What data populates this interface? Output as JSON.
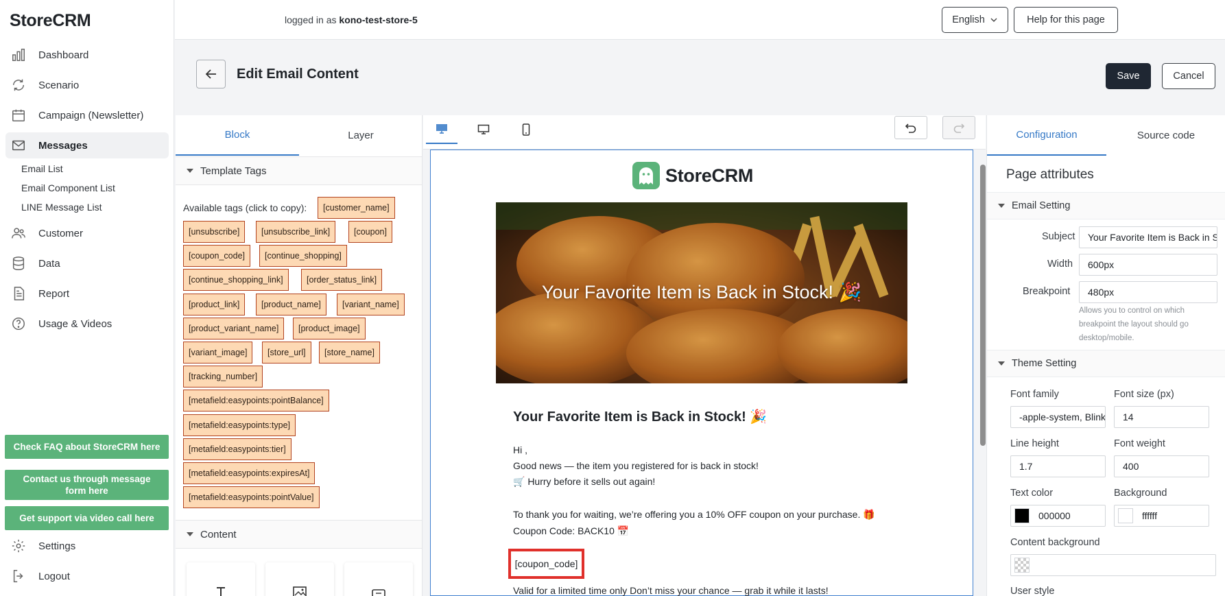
{
  "app": {
    "brand": "StoreCRM",
    "nav": [
      {
        "label": "Dashboard",
        "icon": "bar-chart-icon"
      },
      {
        "label": "Scenario",
        "icon": "refresh-icon"
      },
      {
        "label": "Campaign (Newsletter)",
        "icon": "calendar-icon"
      },
      {
        "label": "Messages",
        "icon": "mail-icon"
      },
      {
        "label": "Customer",
        "icon": "users-icon"
      },
      {
        "label": "Data",
        "icon": "database-icon"
      },
      {
        "label": "Report",
        "icon": "document-icon"
      },
      {
        "label": "Usage & Videos",
        "icon": "help-circle-icon"
      },
      {
        "label": "Settings",
        "icon": "gear-icon"
      },
      {
        "label": "Logout",
        "icon": "logout-icon"
      }
    ],
    "sub_nav": [
      "Email List",
      "Email Component List",
      "LINE Message List"
    ],
    "support_buttons": [
      "Check FAQ about StoreCRM here",
      "Contact us through message form here",
      "Get support via video call here"
    ]
  },
  "topbar": {
    "logged_prefix": "logged in as",
    "store": "kono-test-store-5",
    "language": "English",
    "help": "Help for this page"
  },
  "page": {
    "title": "Edit Email Content",
    "save": "Save",
    "cancel": "Cancel"
  },
  "left_panel": {
    "tabs": [
      "Block",
      "Layer"
    ],
    "template_tags_title": "Template Tags",
    "available_label": "Available tags (click to copy):",
    "tags": [
      "[customer_name]",
      "[unsubscribe]",
      "[unsubscribe_link]",
      "[coupon]",
      "[coupon_code]",
      "[continue_shopping]",
      "[continue_shopping_link]",
      "[order_status_link]",
      "[product_link]",
      "[product_name]",
      "[variant_name]",
      "[product_variant_name]",
      "[product_image]",
      "[variant_image]",
      "[store_url]",
      "[store_name]",
      "[tracking_number]",
      "[metafield:easypoints:pointBalance]",
      "[metafield:easypoints:type]",
      "[metafield:easypoints:tier]",
      "[metafield:easypoints:expiresAt]",
      "[metafield:easypoints:pointValue]"
    ],
    "content_title": "Content"
  },
  "email": {
    "logo_text": "StoreCRM",
    "hero_title": "Your Favorite Item is Back in Stock! 🎉",
    "heading": "Your Favorite Item is Back in Stock! 🎉",
    "greeting": "Hi ,",
    "line1": " Good news — the item you registered for is back in stock!",
    "line2": "🛒 Hurry before it sells out again!",
    "line3": "To thank you for waiting, we’re offering you a 10% OFF coupon on your purchase. 🎁",
    "line4": "Coupon Code: BACK10 📅",
    "coupon_tag": "[coupon_code]",
    "line5": "Valid for a limited time only Don’t miss your chance — grab it while it lasts!"
  },
  "right_panel": {
    "tabs": [
      "Configuration",
      "Source code"
    ],
    "page_attributes": "Page attributes",
    "email_setting": "Email Setting",
    "subject_label": "Subject",
    "subject_value": "Your Favorite Item is Back in Stock! 🎉",
    "width_label": "Width",
    "width_value": "600px",
    "breakpoint_label": "Breakpoint",
    "breakpoint_value": "480px",
    "breakpoint_help": "Allows you to control on which breakpoint the layout should go desktop/mobile.",
    "theme_setting": "Theme Setting",
    "font_family_label": "Font family",
    "font_family_value": "-apple-system, BlinkMacSystemFont",
    "font_size_label": "Font size (px)",
    "font_size_value": "14",
    "line_height_label": "Line height",
    "line_height_value": "1.7",
    "font_weight_label": "Font weight",
    "font_weight_value": "400",
    "text_color_label": "Text color",
    "text_color_value": "000000",
    "background_label": "Background",
    "background_value": "ffffff",
    "content_background_label": "Content background",
    "user_style_label": "User style"
  },
  "colors": {
    "accent": "#3478c6",
    "brand_green": "#5bb37a",
    "tag_fill": "#fdd9b4",
    "tag_border": "#b2431f",
    "highlight": "#e0302b"
  }
}
